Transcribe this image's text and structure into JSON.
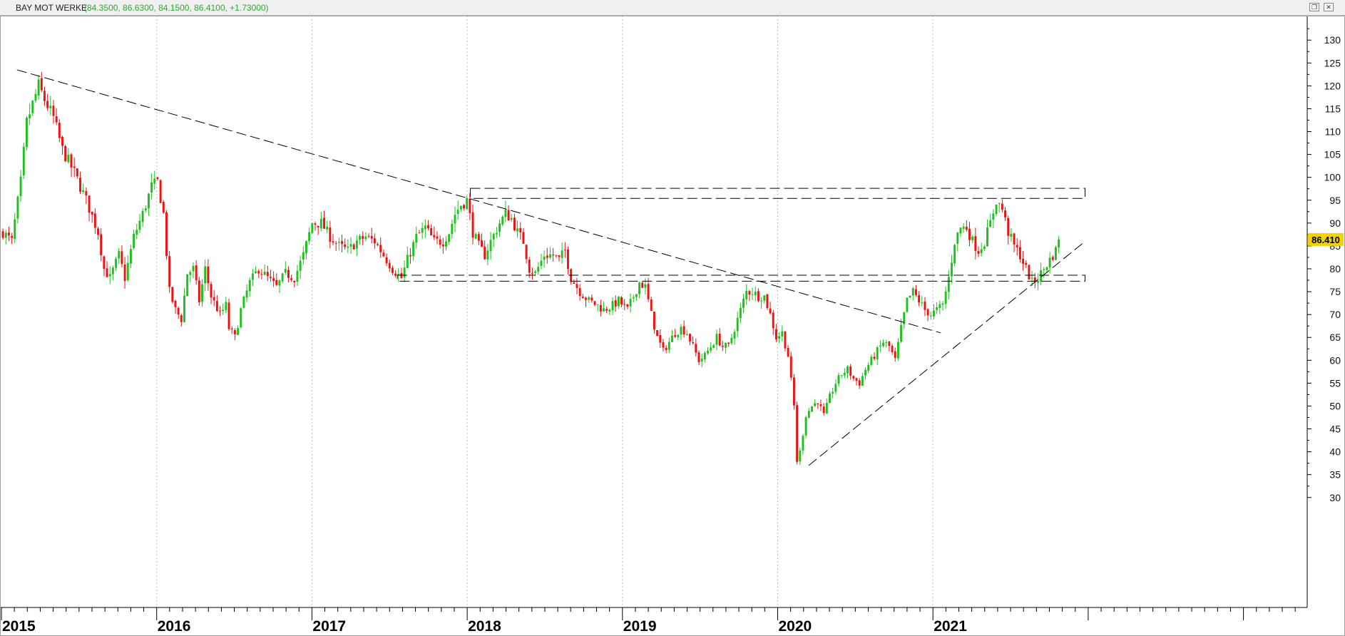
{
  "window": {
    "symbol": "BAY MOT WERKE",
    "ohlc_text": "(84.3500, 86.6300, 84.1500, 86.4100, +1.73000)",
    "restore_glyph": "❐",
    "close_glyph": "✕"
  },
  "chart_data": {
    "type": "candlestick",
    "interval": "weekly",
    "start_year": 2015,
    "x_labels": [
      "2015",
      "2016",
      "2017",
      "2018",
      "2019",
      "2020",
      "2021"
    ],
    "ylim": [
      27,
      133
    ],
    "y_ticks": [
      30,
      35,
      40,
      45,
      50,
      55,
      60,
      65,
      70,
      75,
      80,
      85,
      90,
      95,
      100,
      105,
      110,
      115,
      120,
      125,
      130
    ],
    "last_price_label": "86.410",
    "last_price": 86.41,
    "grid": "vertical dotted at year boundaries",
    "colors": {
      "up": "#1fc11f",
      "down": "#ee1111",
      "last_price_bg": "#f2d200",
      "lines": "#000000"
    },
    "anchors": [
      [
        0,
        88
      ],
      [
        3,
        86
      ],
      [
        6,
        99
      ],
      [
        8,
        112
      ],
      [
        10,
        116
      ],
      [
        12,
        120
      ],
      [
        14,
        117
      ],
      [
        17,
        113
      ],
      [
        20,
        106
      ],
      [
        24,
        101
      ],
      [
        28,
        95
      ],
      [
        32,
        88
      ],
      [
        34,
        80
      ],
      [
        36,
        78
      ],
      [
        39,
        83
      ],
      [
        41,
        78
      ],
      [
        44,
        87
      ],
      [
        47,
        92
      ],
      [
        50,
        98
      ],
      [
        52,
        99
      ],
      [
        54,
        92
      ],
      [
        56,
        75
      ],
      [
        58,
        71
      ],
      [
        60,
        69
      ],
      [
        62,
        79
      ],
      [
        64,
        80
      ],
      [
        66,
        73
      ],
      [
        68,
        80
      ],
      [
        70,
        74
      ],
      [
        73,
        70
      ],
      [
        75,
        72
      ],
      [
        76,
        67
      ],
      [
        78,
        65
      ],
      [
        80,
        71
      ],
      [
        83,
        77
      ],
      [
        86,
        80
      ],
      [
        89,
        78
      ],
      [
        92,
        76
      ],
      [
        95,
        79
      ],
      [
        98,
        78
      ],
      [
        101,
        83
      ],
      [
        104,
        90
      ],
      [
        107,
        90
      ],
      [
        110,
        87
      ],
      [
        113,
        85
      ],
      [
        116,
        84
      ],
      [
        119,
        86
      ],
      [
        122,
        87
      ],
      [
        125,
        86
      ],
      [
        127,
        84
      ],
      [
        129,
        82
      ],
      [
        131,
        80
      ],
      [
        134,
        78
      ],
      [
        136,
        82
      ],
      [
        139,
        87
      ],
      [
        142,
        89
      ],
      [
        145,
        86
      ],
      [
        148,
        86
      ],
      [
        150,
        88
      ],
      [
        152,
        92
      ],
      [
        154,
        94
      ],
      [
        156,
        95
      ],
      [
        158,
        88
      ],
      [
        160,
        85
      ],
      [
        162,
        83
      ],
      [
        164,
        86
      ],
      [
        167,
        90
      ],
      [
        169,
        92
      ],
      [
        171,
        91
      ],
      [
        173,
        88
      ],
      [
        175,
        86
      ],
      [
        177,
        80
      ],
      [
        179,
        79
      ],
      [
        182,
        83
      ],
      [
        185,
        83
      ],
      [
        187,
        82
      ],
      [
        189,
        84
      ],
      [
        191,
        78
      ],
      [
        194,
        75
      ],
      [
        197,
        73
      ],
      [
        200,
        72
      ],
      [
        202,
        71
      ],
      [
        205,
        72
      ],
      [
        207,
        73
      ],
      [
        210,
        71
      ],
      [
        212,
        74
      ],
      [
        214,
        77
      ],
      [
        216,
        76
      ],
      [
        218,
        70
      ],
      [
        220,
        65
      ],
      [
        222,
        62
      ],
      [
        224,
        64
      ],
      [
        226,
        66
      ],
      [
        228,
        67
      ],
      [
        230,
        66
      ],
      [
        232,
        63
      ],
      [
        234,
        60
      ],
      [
        236,
        61
      ],
      [
        238,
        63
      ],
      [
        240,
        65
      ],
      [
        242,
        63
      ],
      [
        244,
        63
      ],
      [
        246,
        67
      ],
      [
        248,
        71
      ],
      [
        250,
        75
      ],
      [
        252,
        75
      ],
      [
        254,
        74
      ],
      [
        256,
        74
      ],
      [
        258,
        70
      ],
      [
        260,
        65
      ],
      [
        262,
        66
      ],
      [
        264,
        61
      ],
      [
        266,
        50
      ],
      [
        267,
        38
      ],
      [
        268,
        40
      ],
      [
        270,
        48
      ],
      [
        272,
        50
      ],
      [
        274,
        51
      ],
      [
        276,
        48
      ],
      [
        278,
        52
      ],
      [
        280,
        55
      ],
      [
        282,
        57
      ],
      [
        284,
        58
      ],
      [
        286,
        56
      ],
      [
        288,
        55
      ],
      [
        290,
        58
      ],
      [
        292,
        60
      ],
      [
        294,
        62
      ],
      [
        296,
        64
      ],
      [
        298,
        63
      ],
      [
        300,
        60
      ],
      [
        302,
        67
      ],
      [
        304,
        73
      ],
      [
        306,
        75
      ],
      [
        308,
        73
      ],
      [
        310,
        71
      ],
      [
        312,
        70
      ],
      [
        314,
        71
      ],
      [
        316,
        72
      ],
      [
        318,
        78
      ],
      [
        320,
        86
      ],
      [
        322,
        89
      ],
      [
        324,
        89
      ],
      [
        326,
        86
      ],
      [
        328,
        84
      ],
      [
        330,
        86
      ],
      [
        332,
        90
      ],
      [
        334,
        95
      ],
      [
        336,
        93
      ],
      [
        338,
        88
      ],
      [
        340,
        85
      ],
      [
        342,
        83
      ],
      [
        344,
        80
      ],
      [
        346,
        77
      ],
      [
        348,
        78
      ],
      [
        350,
        80
      ],
      [
        352,
        82
      ],
      [
        354,
        84
      ],
      [
        355,
        86.41
      ]
    ],
    "trendlines": [
      {
        "from": [
          2015.1,
          123.5
        ],
        "to": [
          2021.05,
          66.0
        ]
      },
      {
        "from": [
          2020.2,
          37.0
        ],
        "to": [
          2021.98,
          86.0
        ]
      }
    ],
    "zones": [
      {
        "from": 2018.02,
        "to": 2021.98,
        "y1": 95.4,
        "y2": 97.6
      },
      {
        "from": 2017.55,
        "to": 2021.98,
        "y1": 77.3,
        "y2": 78.6
      }
    ]
  }
}
